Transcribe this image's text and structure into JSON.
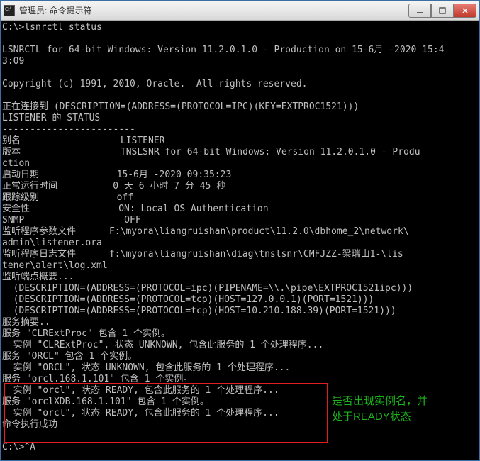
{
  "window": {
    "title": "管理员: 命令提示符"
  },
  "terminal": {
    "prompt1": "C:\\>",
    "cmd1": "lsnrctl status",
    "blank": "",
    "line_banner1": "LSNRCTL for 64-bit Windows: Version 11.2.0.1.0 - Production on 15-6月 -2020 15:4",
    "line_banner2": "3:09",
    "line_copyright": "Copyright (c) 1991, 2010, Oracle.  All rights reserved.",
    "line_connect": "正在连接到 (DESCRIPTION=(ADDRESS=(PROTOCOL=IPC)(KEY=EXTPROC1521)))",
    "line_status_hdr": "LISTENER 的 STATUS",
    "line_dashes": "------------------------",
    "line_alias": "别名                  LISTENER",
    "line_version1": "版本                  TNSLSNR for 64-bit Windows: Version 11.2.0.1.0 - Produ",
    "line_version2": "ction",
    "line_startdate": "启动日期              15-6月 -2020 09:35:23",
    "line_uptime": "正常运行时间          0 天 6 小时 7 分 45 秒",
    "line_trace": "跟踪级别              off",
    "line_security": "安全性                ON: Local OS Authentication",
    "line_snmp": "SNMP                  OFF",
    "line_paramfile1": "监听程序参数文件      F:\\myora\\liangruishan\\product\\11.2.0\\dbhome_2\\network\\",
    "line_paramfile2": "admin\\listener.ora",
    "line_logfile1": "监听程序日志文件      f:\\myora\\liangruishan\\diag\\tnslsnr\\CMFJZZ-梁瑞山1-\\lis",
    "line_logfile2": "tener\\alert\\log.xml",
    "line_endpoints_hdr": "监听端点概要...",
    "line_ep1": "  (DESCRIPTION=(ADDRESS=(PROTOCOL=ipc)(PIPENAME=\\\\.\\pipe\\EXTPROC1521ipc)))",
    "line_ep2": "  (DESCRIPTION=(ADDRESS=(PROTOCOL=tcp)(HOST=127.0.0.1)(PORT=1521)))",
    "line_ep3": "  (DESCRIPTION=(ADDRESS=(PROTOCOL=tcp)(HOST=10.210.188.39)(PORT=1521)))",
    "line_svc_hdr": "服务摘要..",
    "line_svc1a": "服务 \"CLRExtProc\" 包含 1 个实例。",
    "line_svc1b": "  实例 \"CLRExtProc\", 状态 UNKNOWN, 包含此服务的 1 个处理程序...",
    "line_svc2a": "服务 \"ORCL\" 包含 1 个实例。",
    "line_svc2b": "  实例 \"ORCL\", 状态 UNKNOWN, 包含此服务的 1 个处理程序...",
    "line_svc3a": "服务 \"orcl.168.1.101\" 包含 1 个实例。",
    "line_svc3b": "  实例 \"orcl\", 状态 READY, 包含此服务的 1 个处理程序...",
    "line_svc4a": "服务 \"orclXDB.168.1.101\" 包含 1 个实例。",
    "line_svc4b": "  实例 \"orcl\", 状态 READY, 包含此服务的 1 个处理程序...",
    "line_cmdok": "命令执行成功",
    "prompt2": "C:\\>^A"
  },
  "annotation": {
    "line1": "是否出现实例名，并",
    "line2": "处于READY状态"
  }
}
